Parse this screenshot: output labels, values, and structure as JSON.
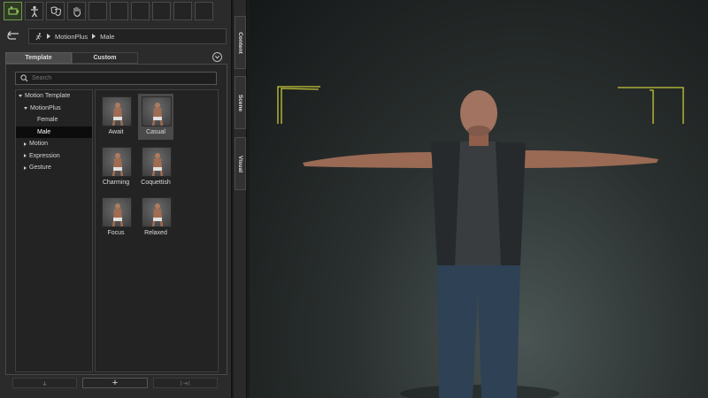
{
  "toolbar": {
    "icons": [
      "camera-motion-icon",
      "body-figure-icon",
      "face-masks-icon",
      "hand-icon"
    ],
    "empty_slots": 6
  },
  "breadcrumb": {
    "items": [
      "MotionPlus",
      "Male"
    ]
  },
  "tabs": {
    "template_label": "Template",
    "custom_label": "Custom"
  },
  "search": {
    "placeholder": "Search"
  },
  "tree": {
    "items": [
      {
        "label": "Motion Template",
        "level": 0,
        "expanded": true,
        "selected": false
      },
      {
        "label": "MotionPlus",
        "level": 1,
        "expanded": true,
        "selected": false
      },
      {
        "label": "Female",
        "level": 2,
        "expanded": null,
        "selected": false
      },
      {
        "label": "Male",
        "level": 2,
        "expanded": null,
        "selected": true
      },
      {
        "label": "Motion",
        "level": 1,
        "expanded": false,
        "selected": false
      },
      {
        "label": "Expression",
        "level": 1,
        "expanded": false,
        "selected": false
      },
      {
        "label": "Gesture",
        "level": 1,
        "expanded": false,
        "selected": false
      }
    ]
  },
  "thumbnails": [
    {
      "label": "Await",
      "selected": false
    },
    {
      "label": "Casual",
      "selected": true
    },
    {
      "label": "Charming",
      "selected": false
    },
    {
      "label": "Coquettish",
      "selected": false
    },
    {
      "label": "Focus",
      "selected": false
    },
    {
      "label": "Relaxed",
      "selected": false
    }
  ],
  "bottom_buttons": {
    "add_label": "+"
  },
  "side_tabs": [
    "Content",
    "Scene",
    "Visual"
  ],
  "colors": {
    "accent_green": "#6f9a4a",
    "corner_marker": "#c8c83a"
  }
}
